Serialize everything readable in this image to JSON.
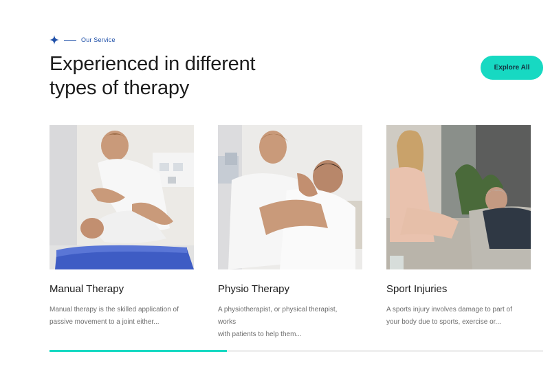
{
  "section": {
    "eyebrow_label": "Our Service",
    "title_line1": "Experienced in different",
    "title_line2": "types of therapy",
    "explore_label": "Explore All"
  },
  "cards": [
    {
      "title": "Manual Therapy",
      "desc_line1": "Manual therapy is the skilled application of",
      "desc_line2": "passive movement to a joint either...",
      "image_alt": "Therapist performing manual therapy on a patient lying on a blue table"
    },
    {
      "title": "Physio Therapy",
      "desc_line1": "A physiotherapist, or physical therapist, works",
      "desc_line2": "with patients to help them...",
      "image_alt": "Physiotherapist supporting a patient's neck and shoulder"
    },
    {
      "title": "Sport Injuries",
      "desc_line1": "A sports injury involves damage to part of",
      "desc_line2": "your body due to sports, exercise or...",
      "image_alt": "Counselor taking notes while a man reclines on a sofa"
    }
  ],
  "carousel": {
    "progress": 0.36
  },
  "colors": {
    "accent": "#17d9c2",
    "brand_blue": "#1e4fa8",
    "text_dark": "#1c1c1c",
    "text_muted": "#6d6d6d"
  }
}
